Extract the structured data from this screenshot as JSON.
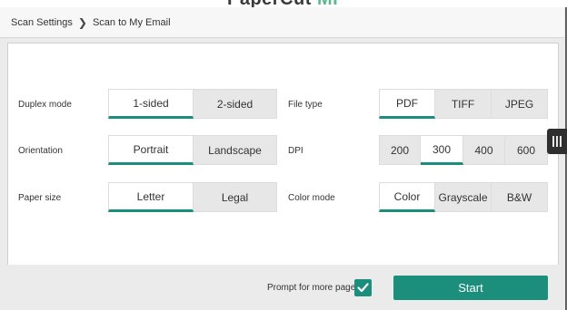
{
  "header": {
    "logo_text": "PaperCut",
    "logo_suffix": "MF"
  },
  "breadcrumb": {
    "root": "Scan Settings",
    "separator": "❯",
    "current": "Scan to My Email"
  },
  "settings": {
    "duplex": {
      "label": "Duplex mode",
      "options": [
        "1-sided",
        "2-sided"
      ],
      "selected": "1-sided"
    },
    "orientation": {
      "label": "Orientation",
      "options": [
        "Portrait",
        "Landscape"
      ],
      "selected": "Portrait"
    },
    "paper_size": {
      "label": "Paper size",
      "options": [
        "Letter",
        "Legal"
      ],
      "selected": "Letter"
    },
    "file_type": {
      "label": "File type",
      "options": [
        "PDF",
        "TIFF",
        "JPEG"
      ],
      "selected": "PDF"
    },
    "dpi": {
      "label": "DPI",
      "options": [
        "200",
        "300",
        "400",
        "600"
      ],
      "selected": "300"
    },
    "color_mode": {
      "label": "Color mode",
      "options": [
        "Color",
        "Grayscale",
        "B&W"
      ],
      "selected": "Color"
    }
  },
  "footer": {
    "prompt_label": "Prompt for more pages",
    "prompt_checked": true,
    "start_label": "Start"
  },
  "colors": {
    "accent": "#1c8f7c",
    "panel": "#ffffff",
    "background": "#ebebeb"
  }
}
